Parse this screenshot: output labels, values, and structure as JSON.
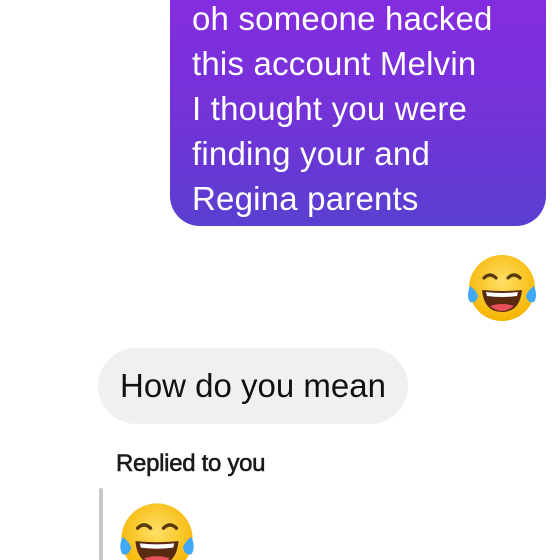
{
  "messages": {
    "sent": {
      "text": "oh someone hacked\nthis account Melvin\nI thought you were\nfinding your and\nRegina parents"
    },
    "received": {
      "text": "How do you mean"
    },
    "reply_context": {
      "label": "Replied to you"
    }
  },
  "icons": {
    "reaction_emoji": "face-with-tears-of-joy-icon",
    "reply_emoji": "face-with-tears-of-joy-icon"
  },
  "colors": {
    "sent_gradient_top": "#8a2be2",
    "sent_gradient_bottom": "#5a3fd0",
    "received_bubble": "#f0f0f2",
    "emoji_face": "#fdc83a",
    "emoji_tears": "#3fa9f5"
  }
}
